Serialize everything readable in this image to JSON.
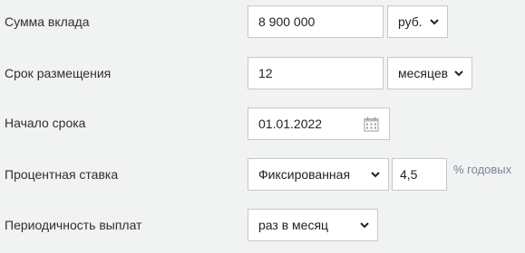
{
  "form": {
    "deposit_amount": {
      "label": "Сумма вклада",
      "value": "8 900 000",
      "currency": "руб."
    },
    "term": {
      "label": "Срок размещения",
      "value": "12",
      "unit": "месяцев"
    },
    "start_date": {
      "label": "Начало срока",
      "value": "01.01.2022"
    },
    "interest_rate": {
      "label": "Процентная ставка",
      "type": "Фиксированная",
      "value": "4,5",
      "unit": "% годовых"
    },
    "payout_frequency": {
      "label": "Периодичность выплат",
      "value": "раз в месяц"
    }
  },
  "colors": {
    "background": "#f1f2f2",
    "field_border": "#c8c8c8",
    "unit_text": "#7a8593"
  }
}
